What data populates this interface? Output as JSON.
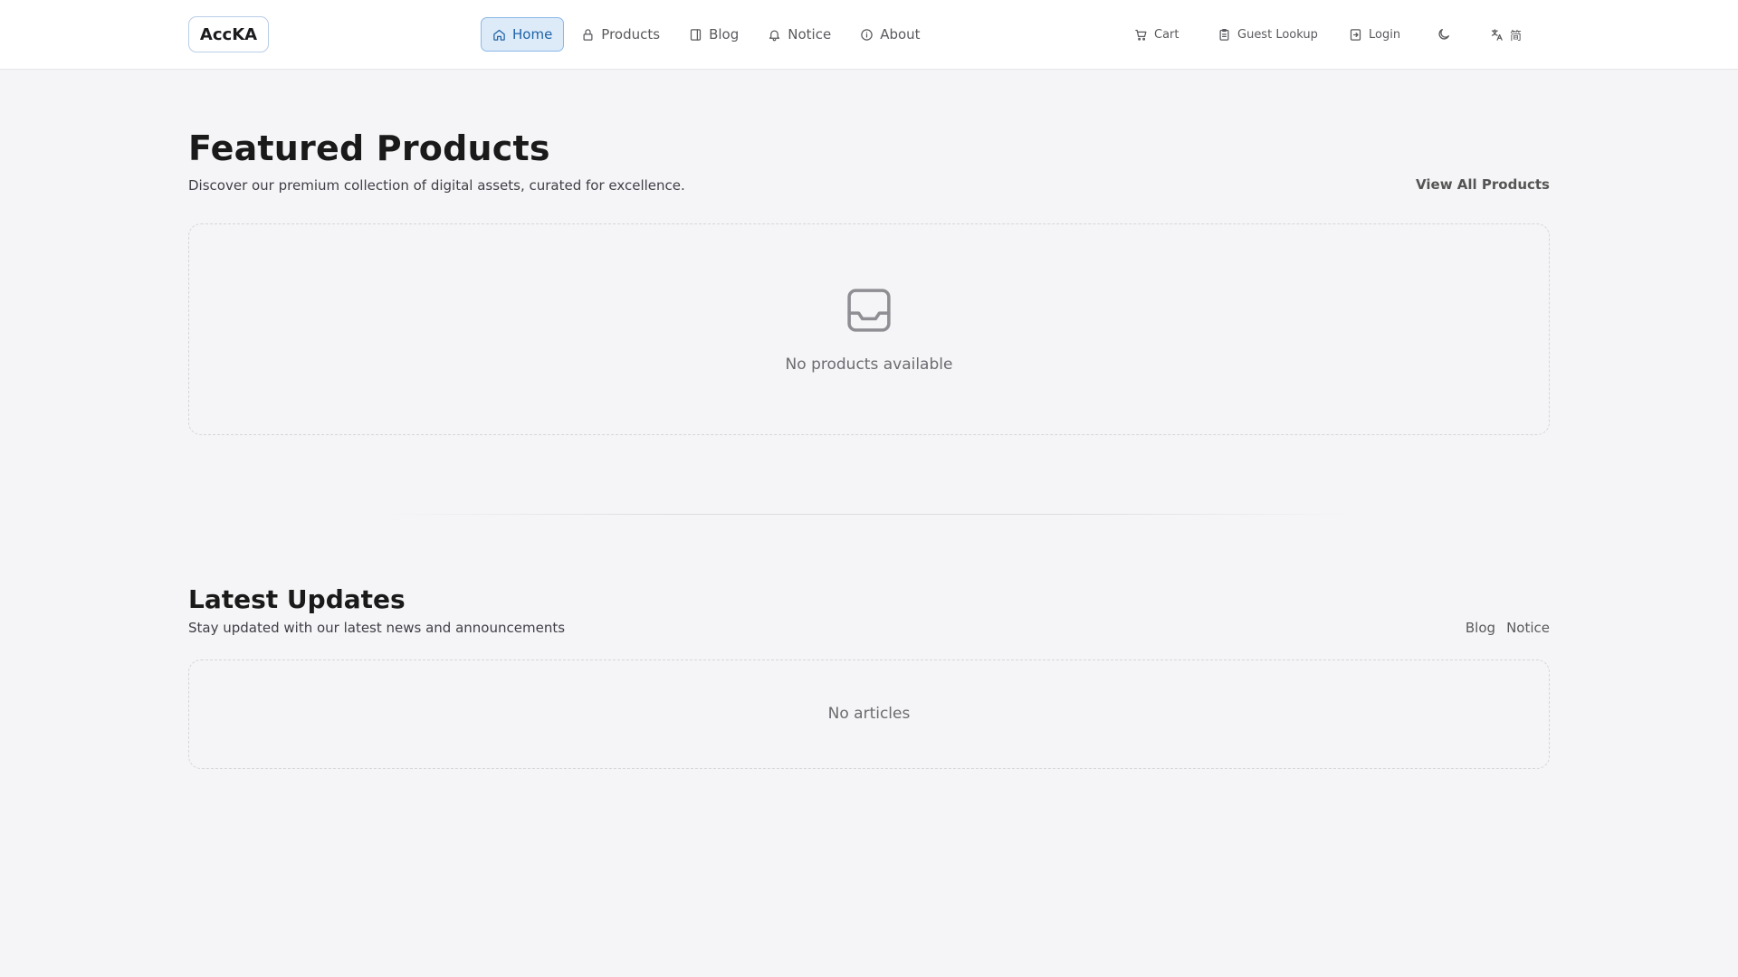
{
  "header": {
    "logo": "AccKA",
    "nav": [
      {
        "label": "Home",
        "icon": "home-icon",
        "active": true
      },
      {
        "label": "Products",
        "icon": "lock-icon",
        "active": false
      },
      {
        "label": "Blog",
        "icon": "book-icon",
        "active": false
      },
      {
        "label": "Notice",
        "icon": "bell-icon",
        "active": false
      },
      {
        "label": "About",
        "icon": "info-icon",
        "active": false
      }
    ],
    "right": {
      "cart": "Cart",
      "guest_lookup": "Guest Lookup",
      "login": "Login",
      "theme_icon": "moon-icon",
      "language_icon": "translate-icon",
      "language": "简"
    }
  },
  "featured": {
    "title": "Featured Products",
    "subtitle": "Discover our premium collection of digital assets, curated for excellence.",
    "view_all": "View All Products",
    "empty_icon": "inbox-icon",
    "empty_text": "No products available"
  },
  "updates": {
    "title": "Latest Updates",
    "subtitle": "Stay updated with our latest news and announcements",
    "links": [
      "Blog",
      "Notice"
    ],
    "empty_text": "No articles"
  },
  "colors": {
    "accent": "#1e63a8",
    "accent_bg": "#ddebf9",
    "page_bg": "#f5f5f7"
  }
}
